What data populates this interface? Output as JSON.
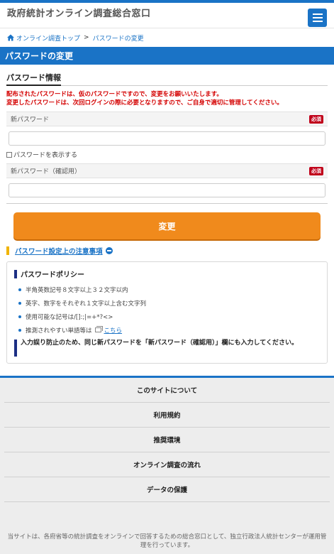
{
  "header": {
    "site_title": "政府統計オンライン調査総合窓口"
  },
  "breadcrumb": {
    "home": "オンライン調査トップ",
    "separator": ">",
    "current": "パスワードの変更"
  },
  "page": {
    "title": "パスワードの変更"
  },
  "section": {
    "title": "パスワード情報",
    "notice_line1": "配布されたパスワードは、仮のパスワードですので、変更をお願いいたします。",
    "notice_line2": "変更したパスワードは、次回ログインの際に必要となりますので、ご自身で適切に管理してください。"
  },
  "form": {
    "new_password_label": "新パスワード",
    "new_password_value": "",
    "required_badge": "必須",
    "show_password_label": "パスワードを表示する",
    "confirm_password_label": "新パスワード（確認用）",
    "confirm_password_value": "",
    "submit_label": "変更"
  },
  "precaution": {
    "link_label": "パスワード設定上の注意事項"
  },
  "policy": {
    "heading": "パスワードポリシー",
    "items": [
      "半角英数記号８文字以上３２文字以内",
      "英字、数字をそれぞれ１文字以上含む文字列",
      "使用可能な記号は/[]:;|=+*?<>",
      "推測されやすい単語等は"
    ],
    "link_label": "こちら",
    "warning": "入力誤り防止のため、同じ新パスワードを「新パスワード（確認用）」欄にも入力してください。"
  },
  "footer": {
    "nav": [
      "このサイトについて",
      "利用規約",
      "推奨環境",
      "オンライン調査の流れ",
      "データの保護"
    ],
    "note": "当サイトは、各府省等の統計調査をオンラインで回答するための総合窓口として、独立行政法人統計センターが運用管理を行っています。"
  },
  "colors": {
    "brand_blue": "#1a73c6",
    "accent_orange": "#f08a1c",
    "notice_red": "#d40000",
    "required_red": "#c0001a"
  },
  "icons": [
    "menu-icon",
    "home-icon",
    "minus-circle-icon",
    "external-window-icon"
  ]
}
